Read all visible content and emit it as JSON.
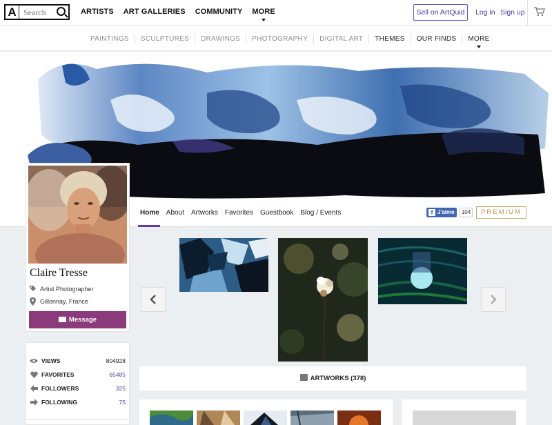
{
  "header": {
    "logo": "A",
    "search_placeholder": "Search",
    "nav": [
      "ARTISTS",
      "ART GALLERIES",
      "COMMUNITY",
      "MORE"
    ],
    "sell_label": "Sell on ArtQuid",
    "login_label": "Log in",
    "signup_label": "Sign up"
  },
  "categories": [
    "PAINTINGS",
    "SCULPTURES",
    "DRAWINGS",
    "PHOTOGRAPHY",
    "DIGITAL ART",
    "THEMES",
    "OUR FINDS",
    "MORE"
  ],
  "profile_tabs": {
    "items": [
      "Home",
      "About",
      "Artworks",
      "Favorites",
      "Guestbook",
      "Blog / Events"
    ],
    "active": "Home",
    "fb_label": "J'aime",
    "fb_count": "104",
    "premium_label": "PREMIUM"
  },
  "profile": {
    "name": "Claire Tresse",
    "role": "Artist Photographer",
    "location": "Gillonnay, France",
    "message_label": "Message"
  },
  "stats": [
    {
      "label": "VIEWS",
      "value": "804928",
      "icon": "eye-icon"
    },
    {
      "label": "FAVORITES",
      "value": "65485",
      "icon": "heart-icon"
    },
    {
      "label": "FOLLOWERS",
      "value": "325",
      "icon": "arrow-left-icon"
    },
    {
      "label": "FOLLOWING",
      "value": "75",
      "icon": "arrow-right-icon"
    }
  ],
  "artworks_label": "ARTWORKS (378)",
  "colors": {
    "accent": "#5b3fa8",
    "message_button": "#8b3a7c",
    "premium": "#c9a76a",
    "facebook": "#4267b2"
  }
}
